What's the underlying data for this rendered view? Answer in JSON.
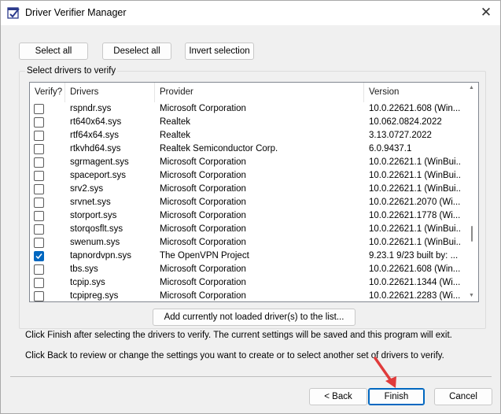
{
  "window": {
    "title": "Driver Verifier Manager"
  },
  "toolbar": {
    "select_all": "Select all",
    "deselect_all": "Deselect all",
    "invert_selection": "Invert selection"
  },
  "group": {
    "label": "Select drivers to verify"
  },
  "table": {
    "headers": {
      "verify": "Verify?",
      "drivers": "Drivers",
      "provider": "Provider",
      "version": "Version"
    },
    "rows": [
      {
        "checked": false,
        "driver": "rspndr.sys",
        "provider": "Microsoft Corporation",
        "version": "10.0.22621.608 (Win..."
      },
      {
        "checked": false,
        "driver": "rt640x64.sys",
        "provider": "Realtek",
        "version": "10.062.0824.2022"
      },
      {
        "checked": false,
        "driver": "rtf64x64.sys",
        "provider": "Realtek",
        "version": "3.13.0727.2022"
      },
      {
        "checked": false,
        "driver": "rtkvhd64.sys",
        "provider": "Realtek Semiconductor Corp.",
        "version": "6.0.9437.1"
      },
      {
        "checked": false,
        "driver": "sgrmagent.sys",
        "provider": "Microsoft Corporation",
        "version": "10.0.22621.1 (WinBui..."
      },
      {
        "checked": false,
        "driver": "spaceport.sys",
        "provider": "Microsoft Corporation",
        "version": "10.0.22621.1 (WinBui..."
      },
      {
        "checked": false,
        "driver": "srv2.sys",
        "provider": "Microsoft Corporation",
        "version": "10.0.22621.1 (WinBui..."
      },
      {
        "checked": false,
        "driver": "srvnet.sys",
        "provider": "Microsoft Corporation",
        "version": "10.0.22621.2070 (Wi..."
      },
      {
        "checked": false,
        "driver": "storport.sys",
        "provider": "Microsoft Corporation",
        "version": "10.0.22621.1778 (Wi..."
      },
      {
        "checked": false,
        "driver": "storqosflt.sys",
        "provider": "Microsoft Corporation",
        "version": "10.0.22621.1 (WinBui..."
      },
      {
        "checked": false,
        "driver": "swenum.sys",
        "provider": "Microsoft Corporation",
        "version": "10.0.22621.1 (WinBui..."
      },
      {
        "checked": true,
        "driver": "tapnordvpn.sys",
        "provider": "The OpenVPN Project",
        "version": "9.23.1 9/23 built by: ..."
      },
      {
        "checked": false,
        "driver": "tbs.sys",
        "provider": "Microsoft Corporation",
        "version": "10.0.22621.608 (Win..."
      },
      {
        "checked": false,
        "driver": "tcpip.sys",
        "provider": "Microsoft Corporation",
        "version": "10.0.22621.1344 (Wi..."
      },
      {
        "checked": false,
        "driver": "tcpipreg.sys",
        "provider": "Microsoft Corporation",
        "version": "10.0.22621.2283 (Wi..."
      }
    ]
  },
  "add_button": "Add currently not loaded driver(s) to the list...",
  "info": {
    "line1": "Click Finish after selecting the drivers to verify. The current settings will be saved and this program will exit.",
    "line2": "Click Back to review or change the settings you want to create or to select another set of drivers to verify."
  },
  "footer": {
    "back": "< Back",
    "finish": "Finish",
    "cancel": "Cancel"
  },
  "colors": {
    "accent": "#0067c0",
    "annotation_arrow": "#e03b3b"
  },
  "icons": {
    "app": "driver-verifier-app-icon",
    "close": "close-icon",
    "annotation": "red-pointer-arrow"
  }
}
